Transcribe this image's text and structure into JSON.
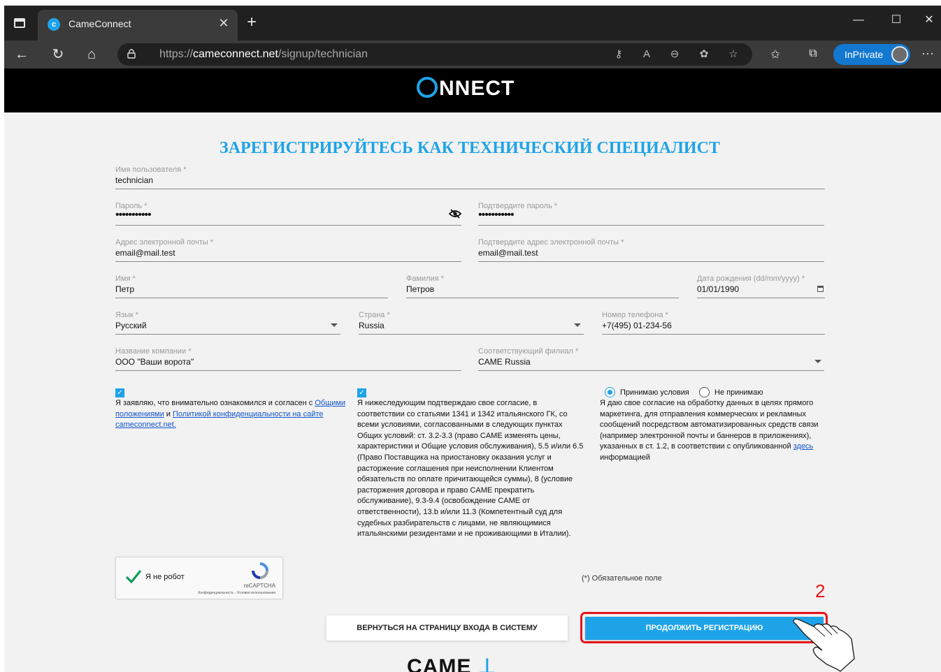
{
  "browser": {
    "tab_title": "CameConnect",
    "url_domain": "cameconnect.net",
    "url_prefix": "https://",
    "url_path": "/signup/technician",
    "inprivate_label": "InPrivate"
  },
  "header": {
    "logo_text": "NNECT"
  },
  "page": {
    "title": "ЗАРЕГИСТРИРУЙТЕСЬ КАК ТЕХНИЧЕСКИЙ СПЕЦИАЛИСТ"
  },
  "form": {
    "username": {
      "label": "Имя пользователя *",
      "value": "technician"
    },
    "password": {
      "label": "Пароль *",
      "value": "•••••••••••"
    },
    "password_confirm": {
      "label": "Подтвердите пароль *",
      "value": "•••••••••••"
    },
    "email": {
      "label": "Адрес электронной почты *",
      "value": "email@mail.test"
    },
    "email_confirm": {
      "label": "Подтвердите адрес электронной почты *",
      "value": "email@mail.test"
    },
    "first_name": {
      "label": "Имя *",
      "value": "Петр"
    },
    "last_name": {
      "label": "Фамилия *",
      "value": "Петров"
    },
    "birth_date": {
      "label": "Дата рождения (dd/mm/yyyy) *",
      "value": "01/01/1990"
    },
    "language": {
      "label": "Язык *",
      "value": "Русский"
    },
    "country": {
      "label": "Страна *",
      "value": "Russia"
    },
    "phone": {
      "label": "Номер телефона *",
      "value": "+7(495) 01-234-56"
    },
    "company": {
      "label": "Название компании *",
      "value": "ООО \"Ваши ворота\""
    },
    "branch": {
      "label": "Соответствующий филиал *",
      "value": "CAME Russia"
    }
  },
  "consent": {
    "terms": {
      "text_before": "Я заявляю, что внимательно ознакомился и согласен с ",
      "link1": "Общими положениями",
      "text_mid": " и ",
      "link2": "Политикой конфиденциальности на сайте cameconnect.net."
    },
    "clauses_text": "Я нижеследующим подтверждаю свое согласие, в соответствии со статьями 1341 и 1342 итальянского ГК, со всеми условиями, согласованными в следующих пунктах Общих условий: ст. 3.2-3.3 (право CAME изменять цены, характеристики и Общие условия обслуживания), 5.5 и/или 6.5 (Право Поставщика на приостановку оказания услуг и расторжение соглашения при неисполнении Клиентом обязательств по оплате причитающейся суммы), 8 (условие расторжения договора и право CAME прекратить обслуживание), 9.3-9.4 (освобождение CAME от ответственности), 13.b и/или 11.3 (Компетентный суд для судебных разбирательств с лицами, не являющимися итальянскими резидентами и не проживающими в Италии).",
    "marketing": {
      "accept_label": "Принимаю условия",
      "decline_label": "Не принимаю",
      "text_before": "Я даю свое согласие на обработку данных в целях прямого маркетинга, для отправления коммерческих и рекламных сообщений посредством автоматизированных средств связи (например электронной почты и баннеров в приложениях), указанных в ст. 1.2, в соответствии с опубликованной ",
      "link": "здесь",
      "text_after": " информацией",
      "selected": "accept"
    }
  },
  "captcha": {
    "label": "Я не робот",
    "brand": "reCAPTCHA",
    "links": "Конфиденциальность - Условия использования"
  },
  "required_note": "(*) Обязательное поле",
  "buttons": {
    "back": "ВЕРНУТЬСЯ НА СТРАНИЦУ ВХОДА В СИСТЕМУ",
    "next": "ПРОДОЛЖИТЬ РЕГИСТРАЦИЮ"
  },
  "annotation": {
    "step_number": "2",
    "color": "#e8141a"
  },
  "footer": {
    "logo_text": "CAME"
  },
  "colors": {
    "accent": "#1fa3e8",
    "header_bg": "#000000",
    "page_bg": "#f2f2f2"
  }
}
